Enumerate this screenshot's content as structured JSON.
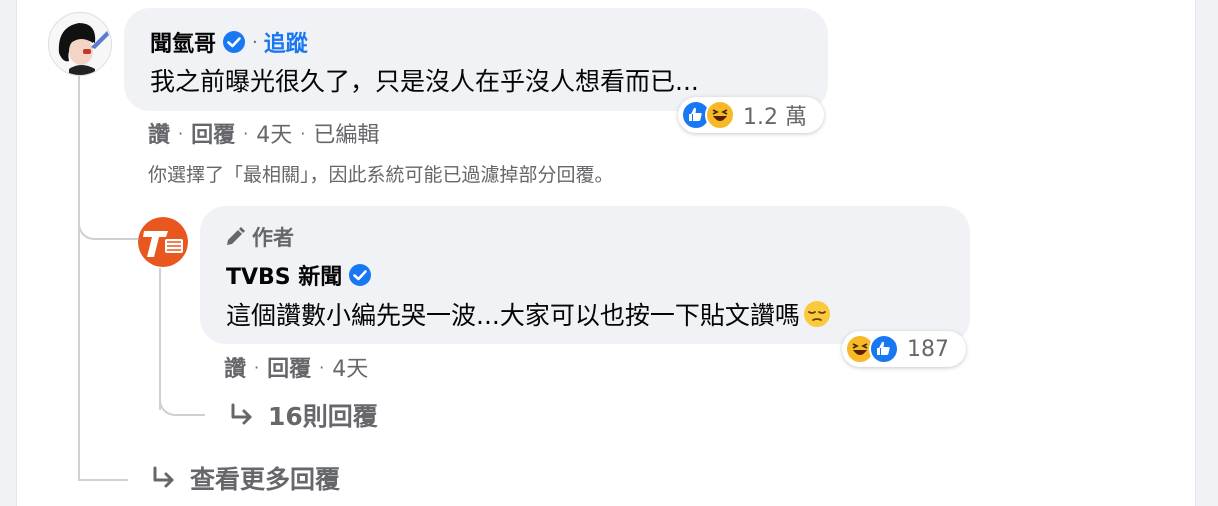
{
  "comment": {
    "author": "聞氫哥",
    "follow_label": "追蹤",
    "separator": "·",
    "text": "我之前曝光很久了，只是沒人在乎沒人想看而已...",
    "reaction_count": "1.2 萬",
    "actions": {
      "like": "讚",
      "reply": "回覆",
      "time": "4天",
      "edited": "已編輯"
    }
  },
  "filter_notice": "你選擇了「最相關」，因此系統可能已過濾掉部分回覆。",
  "reply": {
    "author_badge": "作者",
    "author": "TVBS 新聞",
    "avatar_text": "TVBS 新聞",
    "text": "這個讚數小編先哭一波...大家可以也按一下貼文讚嗎",
    "reaction_count": "187",
    "actions": {
      "like": "讚",
      "reply": "回覆",
      "time": "4天"
    },
    "more_replies": "16則回覆"
  },
  "view_more": "查看更多回覆",
  "colors": {
    "accent": "#1877f2",
    "secondary_text": "#65676b",
    "bubble_bg": "#f0f2f5",
    "tvbs_orange": "#e8571e"
  },
  "icons": {
    "verified": "verified-badge-icon",
    "like": "like-reaction-icon",
    "haha": "haha-reaction-icon",
    "pencil": "pencil-icon",
    "reply_arrow": "reply-arrow-icon",
    "sad_emoji": "pensive-face-icon"
  }
}
